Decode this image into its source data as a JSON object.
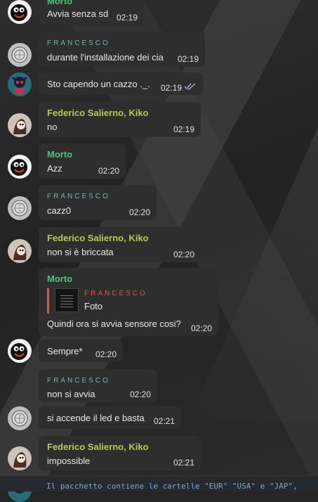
{
  "colors": {
    "morto": "#4ec37e",
    "francesco": "#57c2b6",
    "federico": "#b7c95a",
    "reply_accent": "#e0524d",
    "read_check": "#9ab4cf"
  },
  "messages": [
    {
      "id": "m1",
      "avatar": "morto-avatar",
      "sender": "Morto",
      "text": "Avvia senza sd",
      "time": "02:19"
    },
    {
      "id": "m2",
      "avatar": "francesco-avatar",
      "sender": "FRANCESCO",
      "text": "durante l'installazione dei cia",
      "time": "02:19"
    },
    {
      "id": "m3",
      "avatar": "self-avatar",
      "sender": "",
      "text": "Sto capendo un cazzo ._.",
      "time": "02:19",
      "status": "read-double-check-icon"
    },
    {
      "id": "m4",
      "avatar": "federico-avatar",
      "sender": "Federico Salierno, Kiko",
      "text": "no",
      "time": "02:19"
    },
    {
      "id": "m5",
      "avatar": "morto-avatar",
      "sender": "Morto",
      "text": "Azz",
      "time": "02:20"
    },
    {
      "id": "m6",
      "avatar": "francesco-avatar",
      "sender": "FRANCESCO",
      "text": "cazz0",
      "time": "02:20"
    },
    {
      "id": "m7",
      "avatar": "federico-avatar",
      "sender": "Federico Salierno, Kiko",
      "text": "non si è briccata",
      "time": "02:20"
    },
    {
      "id": "m8",
      "avatar": "morto-avatar",
      "sender": "Morto",
      "reply_to": {
        "sender": "FRANCESCO",
        "text": "Foto"
      },
      "text": "Quindi ora si avvia sensore cosi?",
      "time": "02:20"
    },
    {
      "id": "m9",
      "avatar": "morto-avatar",
      "sender": "",
      "text": "Sempre*",
      "time": "02:20"
    },
    {
      "id": "m10",
      "avatar": "francesco-avatar",
      "sender": "FRANCESCO",
      "text": "non si avvia",
      "time": "02:20"
    },
    {
      "id": "m11",
      "avatar": "francesco-avatar",
      "sender": "",
      "text": "si accende il led e basta",
      "time": "02:21"
    },
    {
      "id": "m12",
      "avatar": "federico-avatar",
      "sender": "Federico Salierno, Kiko",
      "text": "impossible",
      "time": "02:21"
    }
  ],
  "code_preview": "Il pacchetto contiene le cartelle \"EUR\" \"USA\" e \"JAP\","
}
